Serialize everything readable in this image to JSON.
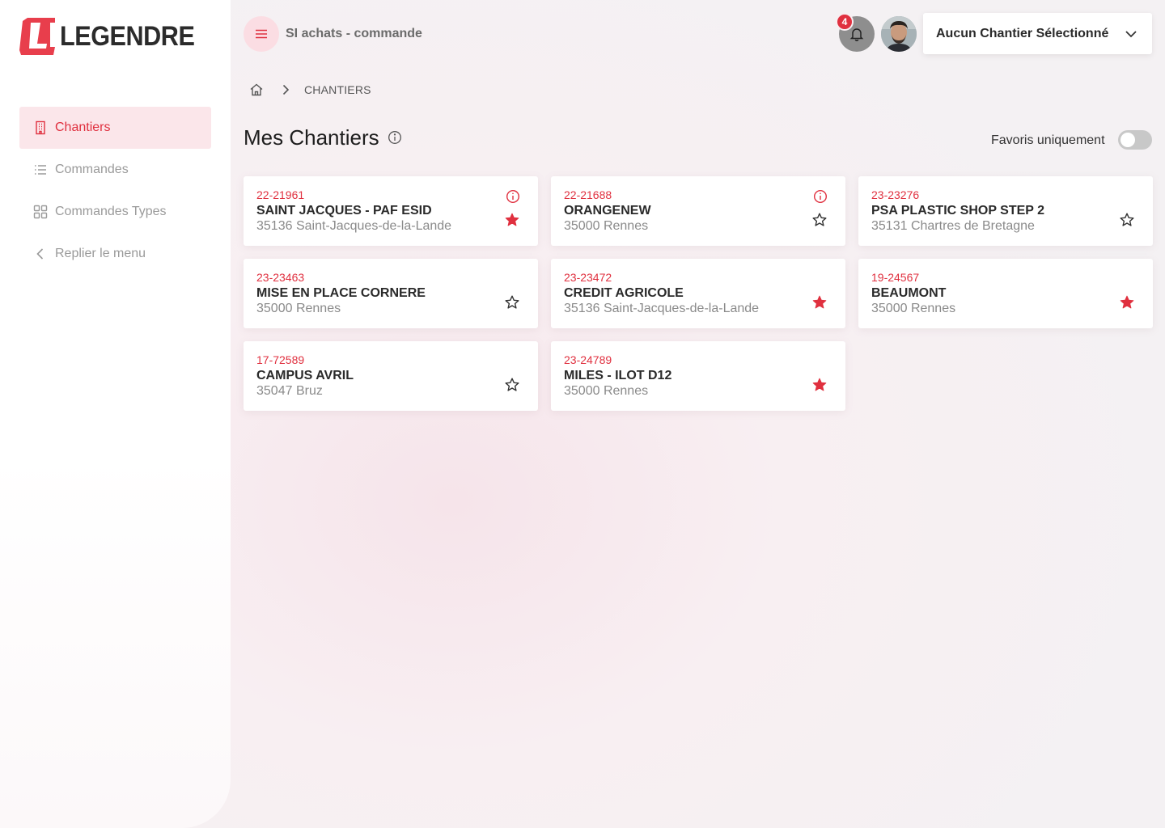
{
  "brand": {
    "name": "LEGENDRE",
    "accent": "#e0303f"
  },
  "sidebar": {
    "items": [
      {
        "label": "Chantiers",
        "icon": "building-icon",
        "active": true
      },
      {
        "label": "Commandes",
        "icon": "list-icon",
        "active": false
      },
      {
        "label": "Commandes Types",
        "icon": "grid-icon",
        "active": false
      },
      {
        "label": "Replier le menu",
        "icon": "chevron-left-icon",
        "active": false
      }
    ]
  },
  "header": {
    "app_title": "SI achats - commande",
    "notifications_count": "4",
    "site_select": "Aucun Chantier Sélectionné"
  },
  "breadcrumb": {
    "current": "CHANTIERS"
  },
  "main": {
    "title": "Mes Chantiers",
    "favorites_label": "Favoris uniquement",
    "favorites_only": false
  },
  "cards": [
    {
      "code": "22-21961",
      "name": "SAINT JACQUES - PAF ESID",
      "city": "35136 Saint-Jacques-de-la-Lande",
      "favorite": true,
      "info": true
    },
    {
      "code": "22-21688",
      "name": "ORANGENEW",
      "city": "35000 Rennes",
      "favorite": false,
      "info": true
    },
    {
      "code": "23-23276",
      "name": "PSA PLASTIC SHOP STEP 2",
      "city": "35131 Chartres de Bretagne",
      "favorite": false,
      "info": false
    },
    {
      "code": "23-23463",
      "name": "MISE EN PLACE CORNERE",
      "city": "35000 Rennes",
      "favorite": false,
      "info": false
    },
    {
      "code": "23-23472",
      "name": "CREDIT AGRICOLE",
      "city": "35136 Saint-Jacques-de-la-Lande",
      "favorite": true,
      "info": false
    },
    {
      "code": "19-24567",
      "name": "BEAUMONT",
      "city": "35000 Rennes",
      "favorite": true,
      "info": false
    },
    {
      "code": "17-72589",
      "name": "CAMPUS AVRIL",
      "city": "35047 Bruz",
      "favorite": false,
      "info": false
    },
    {
      "code": "23-24789",
      "name": "MILES - ILOT D12",
      "city": "35000 Rennes",
      "favorite": true,
      "info": false
    }
  ]
}
